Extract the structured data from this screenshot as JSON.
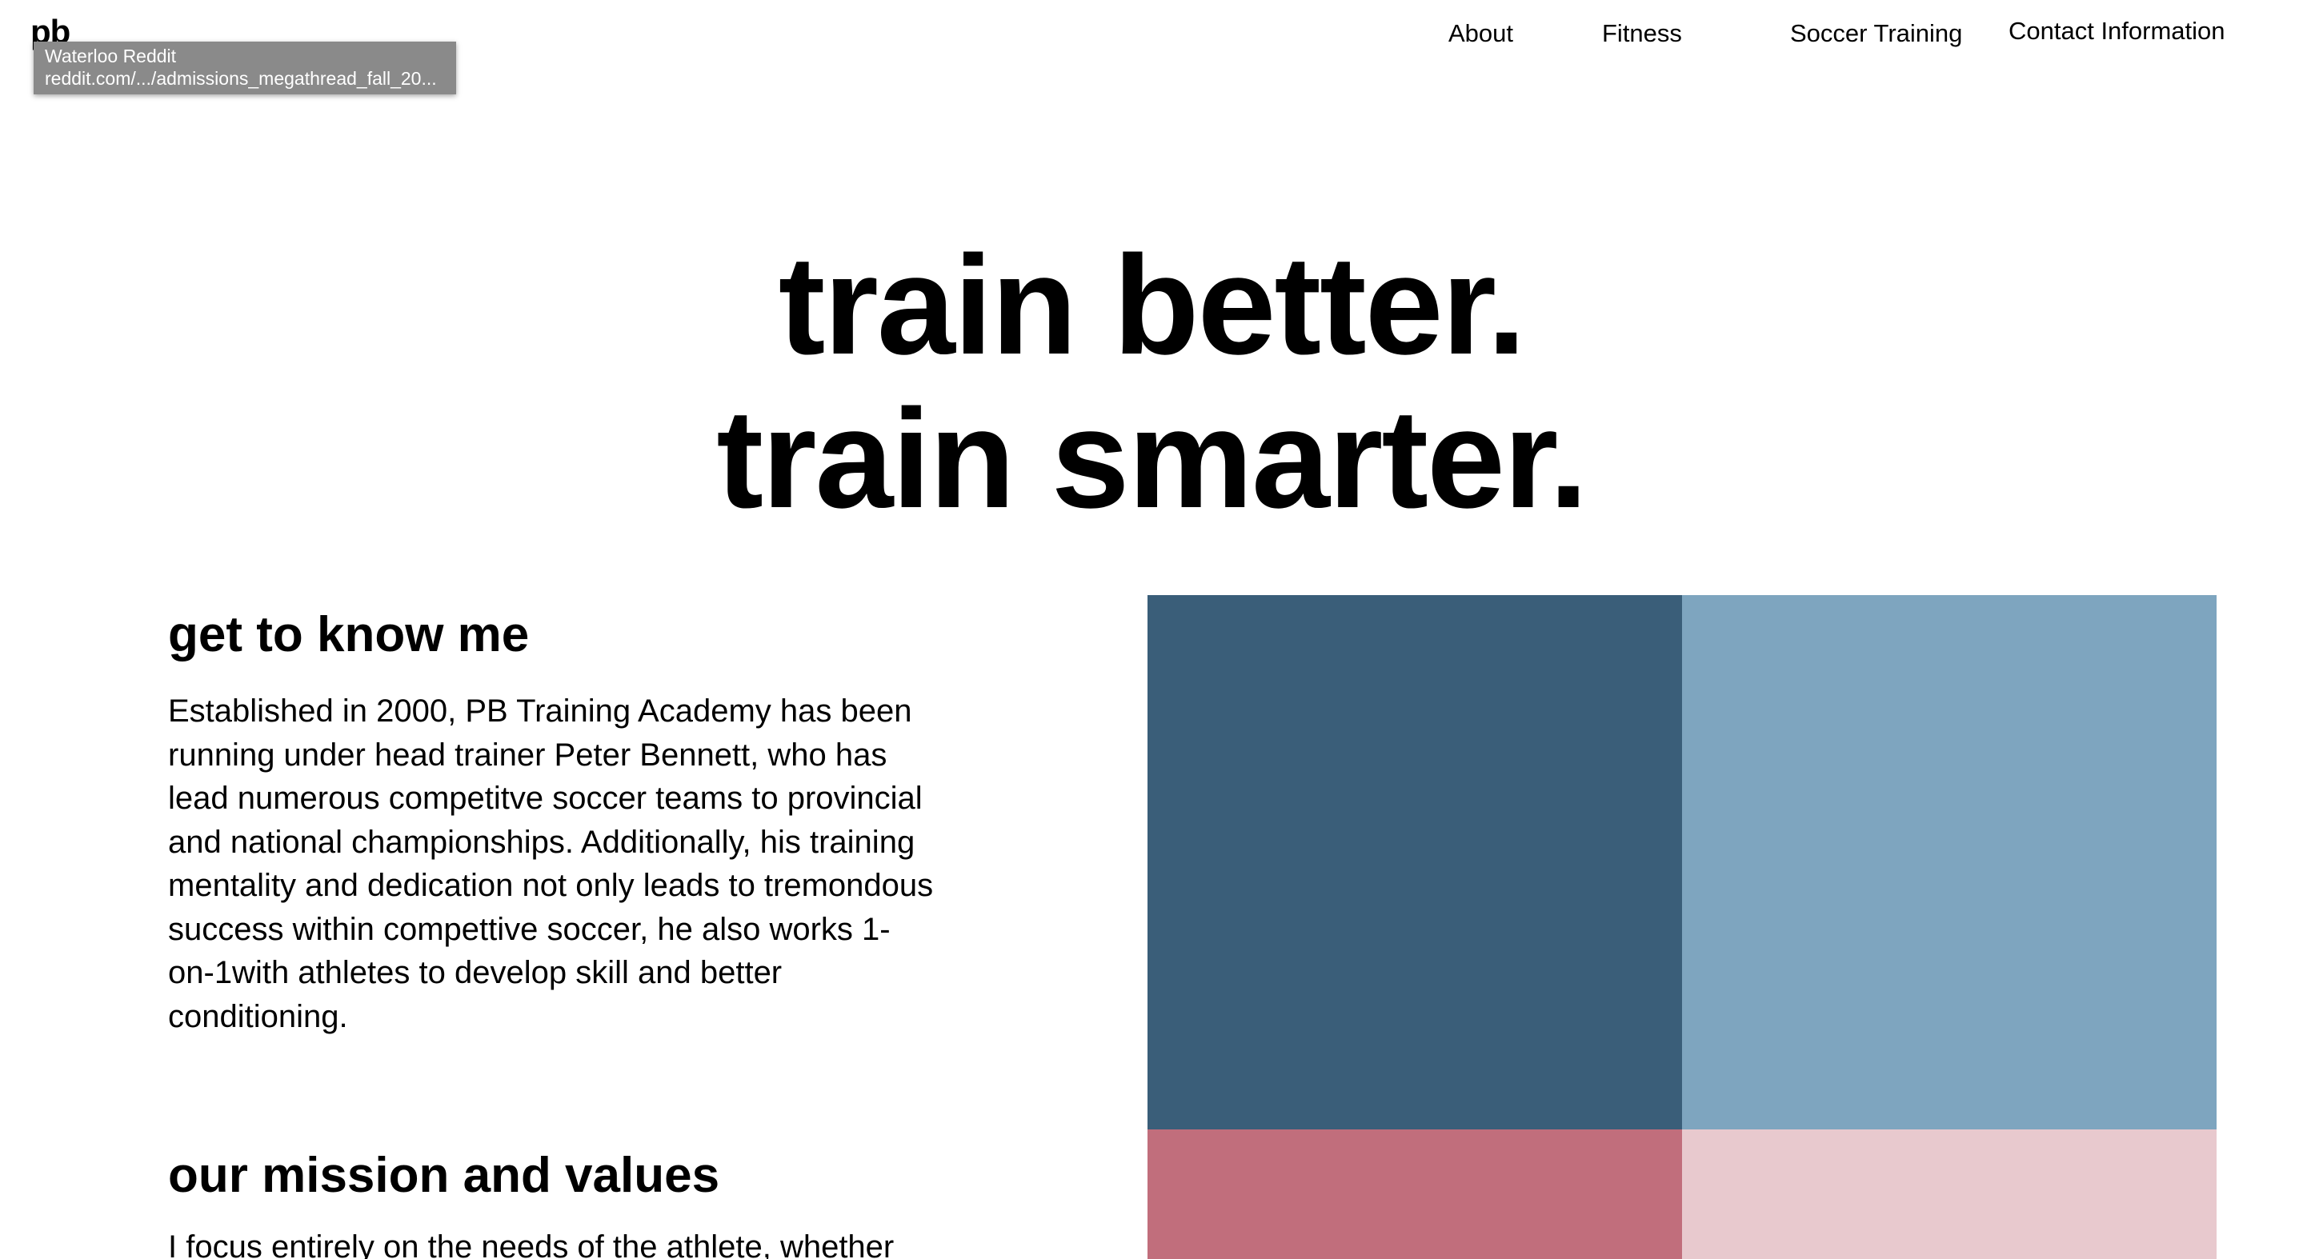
{
  "header": {
    "logo": "pb",
    "nav": [
      {
        "label": "About"
      },
      {
        "label": "Fitness"
      },
      {
        "label": "Soccer Training"
      },
      {
        "label": "Contact Information"
      }
    ]
  },
  "tooltip": {
    "title": "Waterloo Reddit",
    "url": "reddit.com/.../admissions_megathread_fall_20..."
  },
  "hero": {
    "line1": "train better.",
    "line2": "train smarter."
  },
  "about": {
    "heading": "get to know me",
    "body": "Established in 2000, PB Training Academy has been running under head trainer Peter Bennett, who has lead numerous competitve soccer teams to provincial and national championships. Additionally, his training mentality and dedication not only leads to tremondous success within compettive soccer, he also works 1-on-1with athletes to develop skill and better conditioning."
  },
  "mission": {
    "heading": "our mission and values",
    "body": "I focus entirely on the needs of the athlete, whether"
  },
  "color_blocks": [
    {
      "color": "#3a5e79"
    },
    {
      "color": "#7ea5bf"
    },
    {
      "color": "#c16e7c"
    },
    {
      "color": "#e8c9ce"
    }
  ]
}
